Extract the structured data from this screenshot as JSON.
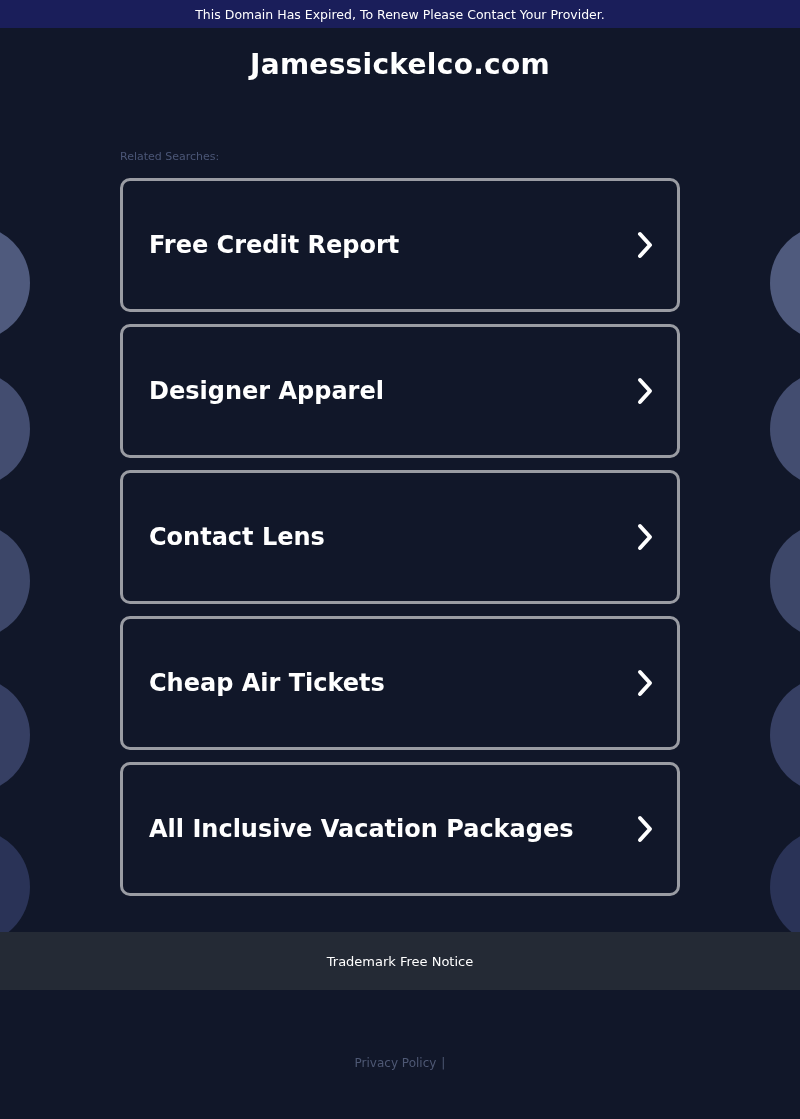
{
  "notice": "This Domain Has Expired, To Renew Please Contact Your Provider.",
  "site_title": "Jamessickelco.com",
  "related_label": "Related Searches:",
  "searches": [
    "Free Credit Report",
    "Designer Apparel",
    "Contact Lens",
    "Cheap Air Tickets",
    "All Inclusive Vacation Packages"
  ],
  "trademark": "Trademark Free Notice",
  "footer_links": [
    "Privacy Policy"
  ],
  "footer_separator": "|"
}
